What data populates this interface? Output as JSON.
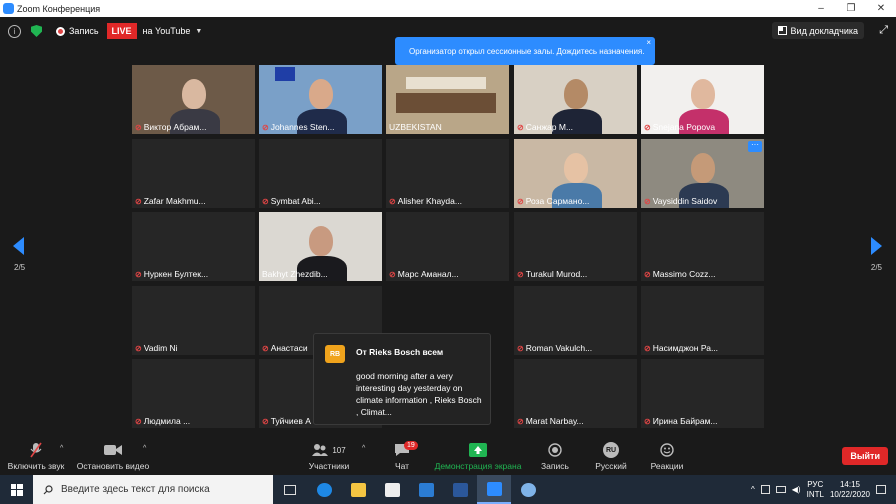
{
  "window": {
    "title": "Zoom Конференция",
    "controls": [
      "–",
      "❐",
      "✕"
    ]
  },
  "topbar": {
    "info_glyph": "i",
    "record_label": "Запись",
    "live_label": "LIVE",
    "stream_target": "на YouTube",
    "speaker_view_label": "Вид докладчика"
  },
  "notice": {
    "text": "Организатор открыл сессионные залы. Дождитесь назначения.",
    "close": "×"
  },
  "pager": {
    "left": "2/5",
    "right": "2/5"
  },
  "tiles": [
    {
      "name": "Виктор Абрам...",
      "muted": true
    },
    {
      "name": "Johannes Sten...",
      "muted": true
    },
    {
      "name": "UZBEKISTAN",
      "muted": false
    },
    {
      "name": "Санжар М...",
      "muted": true
    },
    {
      "name": "Snejana Popova",
      "muted": true
    },
    {
      "name": "Zafar Makhmu...",
      "muted": true
    },
    {
      "name": "Symbat Abi...",
      "muted": true
    },
    {
      "name": "Alisher Khayda...",
      "muted": true
    },
    {
      "name": "Роза Сармано...",
      "muted": true
    },
    {
      "name": "Vaysiddin Saidov",
      "muted": true
    },
    {
      "name": "Нуркен Бултек...",
      "muted": true
    },
    {
      "name": "Bakhyt Zhezdib...",
      "muted": false
    },
    {
      "name": "Марс Аманал...",
      "muted": true
    },
    {
      "name": "Turakul Murod...",
      "muted": true
    },
    {
      "name": "Massimo Cozz...",
      "muted": true
    },
    {
      "name": "Vadim Ni",
      "muted": true
    },
    {
      "name": "Анастаси",
      "muted": true
    },
    {
      "name": "",
      "muted": false
    },
    {
      "name": "Roman Vakulch...",
      "muted": true
    },
    {
      "name": "Насимджон Ра...",
      "muted": true
    },
    {
      "name": "Людмила ...",
      "muted": true
    },
    {
      "name": "Туйчиев А",
      "muted": true
    },
    {
      "name": "",
      "muted": false
    },
    {
      "name": "Marat Narbay...",
      "muted": true
    },
    {
      "name": "Ирина Байрам...",
      "muted": true
    }
  ],
  "chat_popup": {
    "avatar": "RB",
    "from": "От Rieks Bosch всем",
    "message": "good morning after a very interesting day yesterday on climate information , Rieks Bosch , Climat..."
  },
  "toolbar": {
    "mute_label": "Включить звук",
    "video_label": "Остановить видео",
    "participants_count": "107",
    "participants_label": "Участники",
    "chat_label": "Чат",
    "chat_badge": "19",
    "share_label": "Демонстрация экрана",
    "record_label": "Запись",
    "lang_code": "RU",
    "lang_label": "Русский",
    "reactions_label": "Реакции",
    "leave_label": "Выйти"
  },
  "taskbar": {
    "search_placeholder": "Введите здесь текст для поиска",
    "lang_top": "РУС",
    "lang_bottom": "INTL",
    "time": "14:15",
    "date": "10/22/2020"
  },
  "colors": {
    "accent": "#2d8cff",
    "danger": "#e02828",
    "share": "#20b552",
    "chat_avatar": "#f0a31c"
  }
}
